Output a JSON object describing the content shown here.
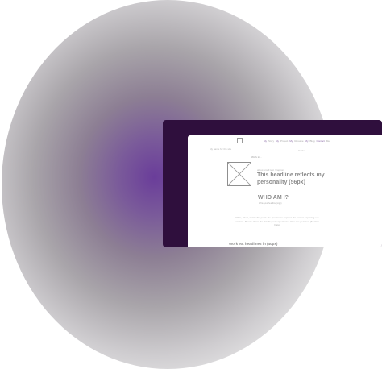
{
  "nav": {
    "links": [
      "My",
      "Story",
      "My",
      "Project",
      "My",
      "Resume",
      "My",
      "Blog",
      "Contact",
      "Me"
    ]
  },
  "sub_left": "My name for the site",
  "sub_right": "Center",
  "note_top": "Work in...",
  "eyebrow": "about small text / caption",
  "headline": "This headline reflects my personality (56px)",
  "who_heading": "WHO AM I?",
  "who_sub": "Write your headline (sign)",
  "body_copy": "Write, short, and to the point: the greatest to impress the person exploring our content. Please share the details your experience, all in one year text (Section Data)",
  "work_heading": "Work ex. headline2 in (40px)",
  "colors": {
    "device_frame": "#2f0f3d",
    "glow": "#6a3d9a",
    "accent_link": "#8a6aa6"
  }
}
